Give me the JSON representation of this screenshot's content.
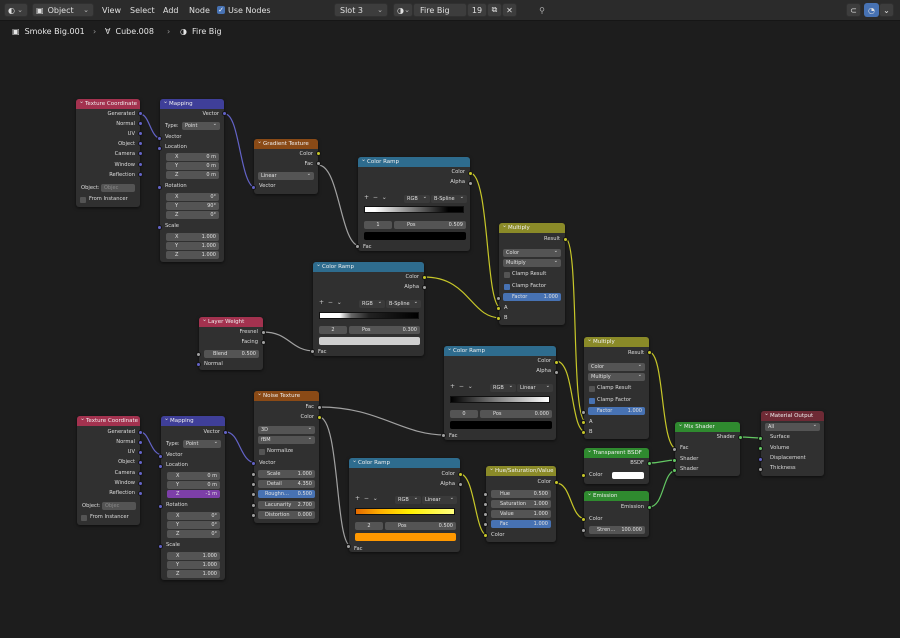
{
  "header": {
    "editor_icon": "node-editor-icon",
    "mode": "Object",
    "menus": [
      "View",
      "Select",
      "Add",
      "Node"
    ],
    "use_nodes": "Use Nodes",
    "slot": "Slot 3",
    "material_name": "Fire Big",
    "user_count": "19"
  },
  "breadcrumb": {
    "object": "Smoke Big.001",
    "mesh": "Cube.008",
    "material": "Fire Big"
  },
  "colors": {
    "texture_header": "#a3324f",
    "vector_header": "#3f3f99",
    "color_header": "#2e6c8e",
    "shader_header": "#2f8a2f",
    "output_header": "#6e2a35",
    "converter_header": "#7c5a10",
    "input_header": "#a3324f",
    "link_yellow": "#c7c729",
    "link_gray": "#a1a1a1",
    "link_purple": "#6363c7",
    "link_green": "#63c763"
  },
  "nodes": {
    "texcoord1": {
      "title": "Texture Coordinate",
      "outputs": [
        "Generated",
        "Normal",
        "UV",
        "Object",
        "Camera",
        "Window",
        "Reflection"
      ],
      "object_label": "Object:",
      "object_placeholder": "Objec",
      "from_instancer": "From Instancer"
    },
    "mapping1": {
      "title": "Mapping",
      "out": "Vector",
      "type_label": "Type:",
      "type_value": "Point",
      "vector": "Vector",
      "location": "Location",
      "loc": [
        [
          "X",
          "0 m"
        ],
        [
          "Y",
          "0 m"
        ],
        [
          "Z",
          "0 m"
        ]
      ],
      "rotation": "Rotation",
      "rot": [
        [
          "X",
          "0°"
        ],
        [
          "Y",
          "90°"
        ],
        [
          "Z",
          "0°"
        ]
      ],
      "scale": "Scale",
      "scl": [
        [
          "X",
          "1.000"
        ],
        [
          "Y",
          "1.000"
        ],
        [
          "Z",
          "1.000"
        ]
      ]
    },
    "gradient": {
      "title": "Gradient Texture",
      "outputs": [
        "Color",
        "Fac"
      ],
      "type": "Linear",
      "vector": "Vector"
    },
    "ramp1": {
      "title": "Color Ramp",
      "outputs": [
        "Color",
        "Alpha"
      ],
      "mode": "RGB",
      "interp": "B-Spline",
      "index": "1",
      "pos_label": "Pos",
      "pos": "0.509",
      "input": "Fac"
    },
    "multiply1": {
      "title": "Multiply",
      "out": "Result",
      "type": "Color",
      "op": "Multiply",
      "clamp_result": "Clamp Result",
      "clamp_factor": "Clamp Factor",
      "factor_label": "Factor",
      "factor": "1.000",
      "inputs": [
        "A",
        "B"
      ]
    },
    "ramp2": {
      "title": "Color Ramp",
      "outputs": [
        "Color",
        "Alpha"
      ],
      "mode": "RGB",
      "interp": "B-Spline",
      "index": "2",
      "pos_label": "Pos",
      "pos": "0.300",
      "input": "Fac"
    },
    "layerweight": {
      "title": "Layer Weight",
      "outputs": [
        "Fresnel",
        "Facing"
      ],
      "blend_label": "Blend",
      "blend": "0.500",
      "normal": "Normal"
    },
    "ramp3": {
      "title": "Color Ramp",
      "outputs": [
        "Color",
        "Alpha"
      ],
      "mode": "RGB",
      "interp": "Linear",
      "index": "0",
      "pos_label": "Pos",
      "pos": "0.000",
      "input": "Fac"
    },
    "multiply2": {
      "title": "Multiply",
      "out": "Result",
      "type": "Color",
      "op": "Multiply",
      "clamp_result": "Clamp Result",
      "clamp_factor": "Clamp Factor",
      "factor_label": "Factor",
      "factor": "1.000",
      "inputs": [
        "A",
        "B"
      ]
    },
    "mixshader": {
      "title": "Mix Shader",
      "out": "Shader",
      "inputs": [
        "Fac",
        "Shader",
        "Shader"
      ]
    },
    "output": {
      "title": "Material Output",
      "target": "All",
      "inputs": [
        "Surface",
        "Volume",
        "Displacement",
        "Thickness"
      ]
    },
    "transparent": {
      "title": "Transparent BSDF",
      "out": "BSDF",
      "input": "Color"
    },
    "emission": {
      "title": "Emission",
      "out": "Emission",
      "input": "Color",
      "strength_label": "Stren…",
      "strength": "100.000"
    },
    "texcoord2": {
      "title": "Texture Coordinate",
      "outputs": [
        "Generated",
        "Normal",
        "UV",
        "Object",
        "Camera",
        "Window",
        "Reflection"
      ],
      "object_label": "Object:",
      "object_placeholder": "Objec",
      "from_instancer": "From Instancer"
    },
    "mapping2": {
      "title": "Mapping",
      "out": "Vector",
      "type_label": "Type:",
      "type_value": "Point",
      "vector": "Vector",
      "location": "Location",
      "loc": [
        [
          "X",
          "0 m"
        ],
        [
          "Y",
          "0 m"
        ],
        [
          "Z",
          "-1 m"
        ]
      ],
      "rotation": "Rotation",
      "rot": [
        [
          "X",
          "0°"
        ],
        [
          "Y",
          "0°"
        ],
        [
          "Z",
          "0°"
        ]
      ],
      "scale": "Scale",
      "scl": [
        [
          "X",
          "1.000"
        ],
        [
          "Y",
          "1.000"
        ],
        [
          "Z",
          "1.000"
        ]
      ]
    },
    "noise": {
      "title": "Noise Texture",
      "outputs": [
        "Fac",
        "Color"
      ],
      "dim": "3D",
      "type": "fBM",
      "normalize": "Normalize",
      "vector": "Vector",
      "params": [
        [
          "Scale",
          "1.000"
        ],
        [
          "Detail",
          "4.350"
        ],
        [
          "Roughn…",
          "0.500"
        ],
        [
          "Lacunarity",
          "2.700"
        ],
        [
          "Distortion",
          "0.000"
        ]
      ]
    },
    "ramp4": {
      "title": "Color Ramp",
      "outputs": [
        "Color",
        "Alpha"
      ],
      "mode": "RGB",
      "interp": "Linear",
      "index": "2",
      "pos_label": "Pos",
      "pos": "0.500",
      "input": "Fac"
    },
    "hsv": {
      "title": "Hue/Saturation/Value",
      "out": "Color",
      "params": [
        [
          "Hue",
          "0.500"
        ],
        [
          "Saturation",
          "1.000"
        ],
        [
          "Value",
          "1.000"
        ],
        [
          "Fac",
          "1.000"
        ]
      ],
      "input": "Color"
    }
  }
}
